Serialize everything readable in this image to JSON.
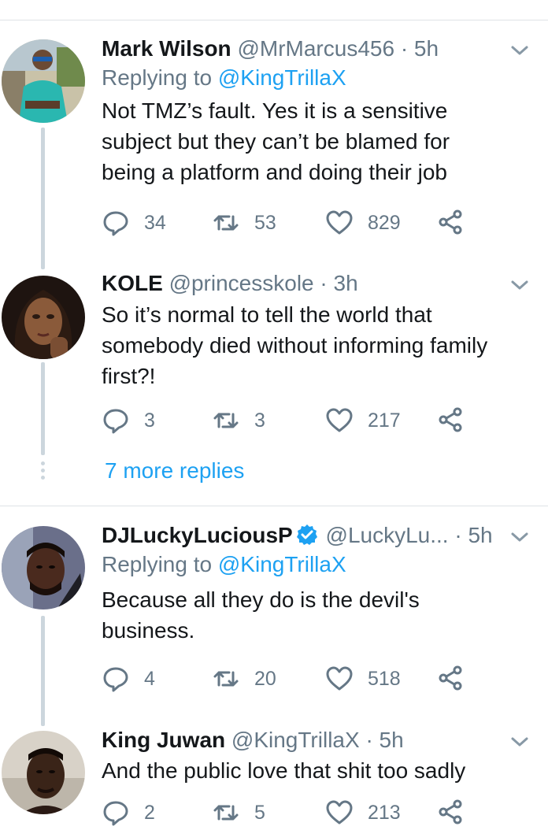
{
  "tweets": [
    {
      "name": "Mark Wilson",
      "handle": "@MrMarcus456",
      "time": "· 5h",
      "replying_label": "Replying to",
      "replying_to": "@KingTrillaX",
      "text": "Not TMZ’s fault. Yes it is a sensitive\nsubject but they can’t be blamed for\nbeing a platform and doing their job",
      "replies": "34",
      "retweets": "53",
      "likes": "829"
    },
    {
      "name": "KOLE",
      "handle": "@princesskole",
      "time": "· 3h",
      "text": "So it’s normal to tell the world that\nsomebody died without informing family\nfirst?!",
      "replies": "3",
      "retweets": "3",
      "likes": "217"
    },
    {
      "name": "DJLuckyLuciousP",
      "handle": "@LuckyLu...",
      "time": "· 5h",
      "verified": true,
      "replying_label": "Replying to",
      "replying_to": "@KingTrillaX",
      "text": "Because all they do is the devil's\nbusiness.",
      "replies": "4",
      "retweets": "20",
      "likes": "518"
    },
    {
      "name": "King Juwan",
      "handle": "@KingTrillaX",
      "time": "· 5h",
      "text": "And the public love that shit too sadly",
      "replies": "2",
      "retweets": "5",
      "likes": "213"
    }
  ],
  "more_replies": "7 more replies",
  "colors": {
    "accent": "#1da1f2",
    "meta": "#657786",
    "line": "#ccd6dd"
  },
  "icons": [
    "reply-icon",
    "retweet-icon",
    "like-icon",
    "share-icon",
    "chevron-down-icon",
    "verified-badge-icon"
  ]
}
